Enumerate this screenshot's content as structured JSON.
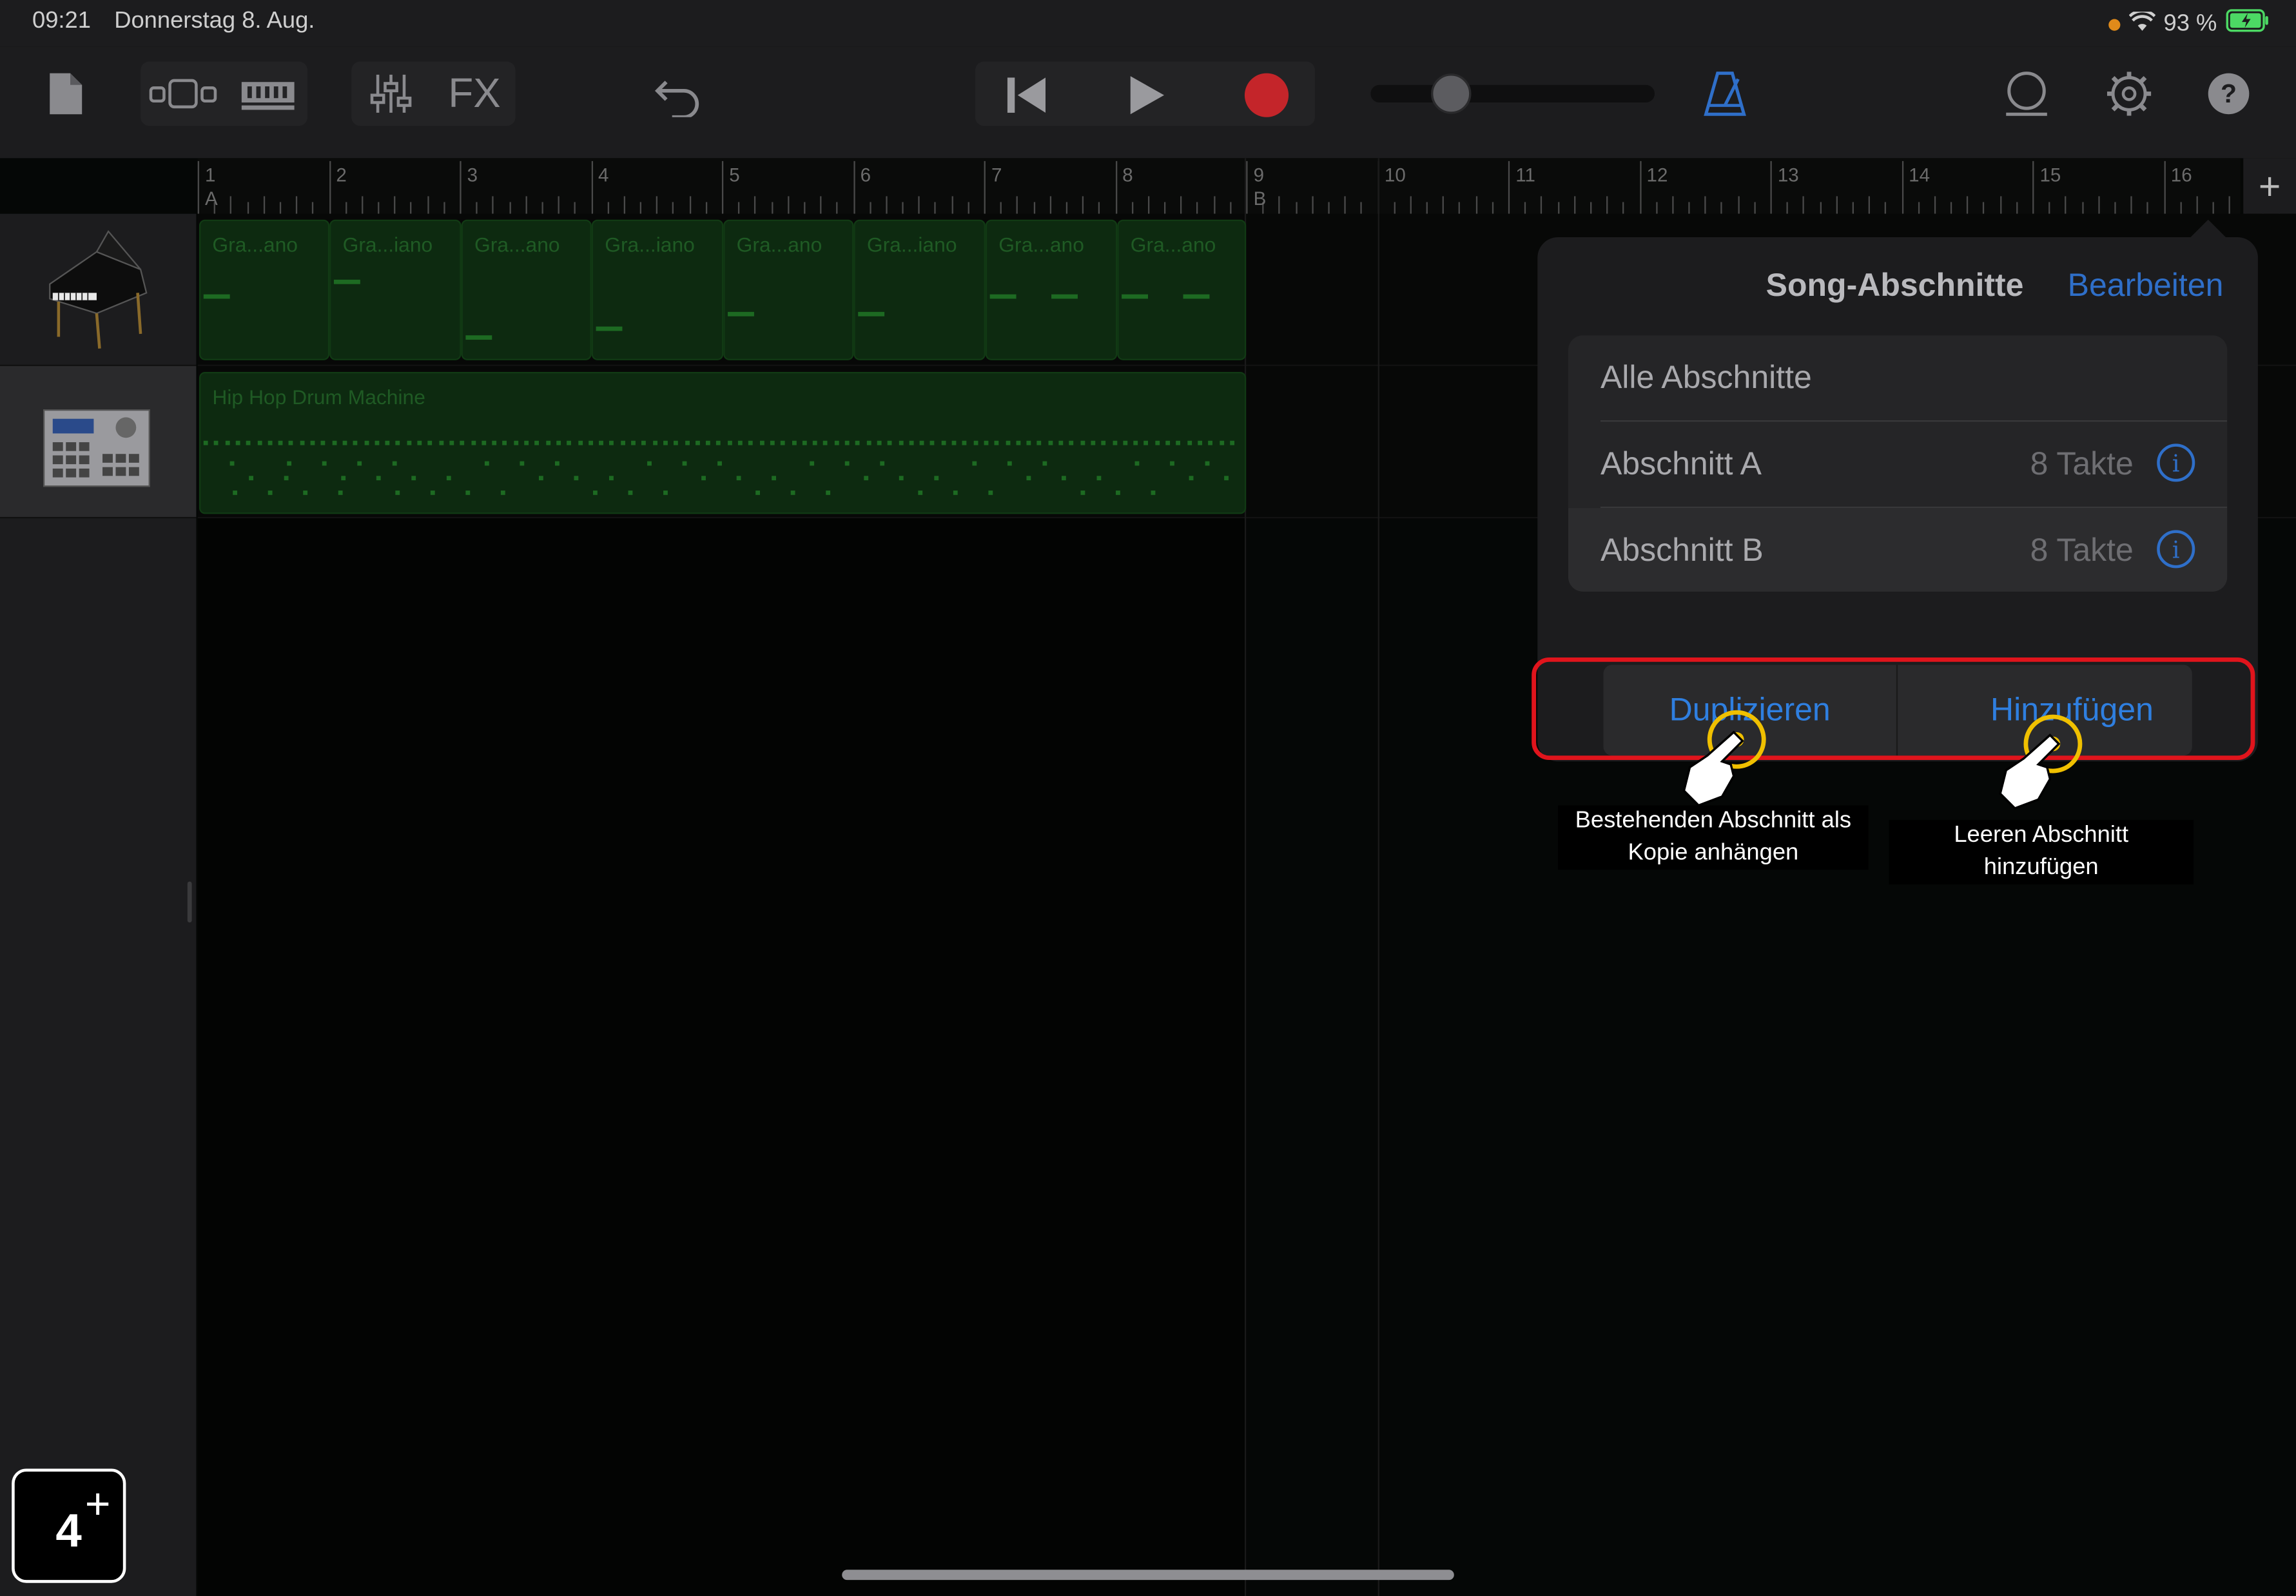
{
  "status_bar": {
    "time": "09:21",
    "date": "Donnerstag 8. Aug.",
    "battery": "93 %"
  },
  "toolbar": {
    "fx_label": "FX",
    "icons": [
      "document-icon",
      "view-toggle-icon",
      "tracks-icon",
      "mixer-icon",
      "fx-icon",
      "undo-icon",
      "rewind-icon",
      "play-icon",
      "record-icon",
      "volume-slider",
      "metronome-icon",
      "loop-icon",
      "settings-icon",
      "help-icon"
    ],
    "accent": "#2f6fc9",
    "record_color": "#c4252a"
  },
  "ruler": {
    "bars": [
      "1",
      "2",
      "3",
      "4",
      "5",
      "6",
      "7",
      "8",
      "9",
      "10",
      "11",
      "12",
      "13",
      "14",
      "15",
      "16"
    ],
    "section_marks": [
      "A",
      "B"
    ],
    "add_label": "+"
  },
  "tracks": [
    {
      "name": "grand-piano",
      "regions": [
        "Gra...ano",
        "Gra...iano",
        "Gra...ano",
        "Gra...iano",
        "Gra...ano",
        "Gra...iano",
        "Gra...ano",
        "Gra...ano"
      ]
    },
    {
      "name": "drum-machine",
      "regions": [
        "Hip Hop Drum Machine"
      ]
    }
  ],
  "popover": {
    "title": "Song-Abschnitte",
    "edit": "Bearbeiten",
    "all_sections": "Alle Abschnitte",
    "sections": [
      {
        "label": "Abschnitt A",
        "value": "8 Takte",
        "info": "i"
      },
      {
        "label": "Abschnitt B",
        "value": "8 Takte",
        "info": "i"
      }
    ],
    "duplicate": "Duplizieren",
    "add": "Hinzufügen"
  },
  "callouts": {
    "duplicate_note": "Bestehenden Abschnitt als Kopie anhängen",
    "add_note": "Leeren Abschnitt hinzufügen"
  },
  "step_badge": {
    "number": "4",
    "plus": "+"
  }
}
